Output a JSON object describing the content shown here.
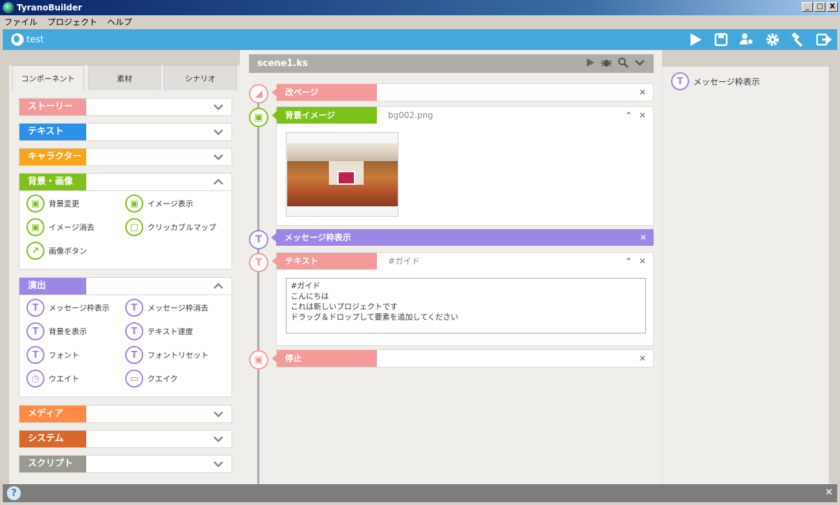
{
  "window": {
    "title": "TyranoBuilder",
    "minimize": "_",
    "maximize": "□",
    "close": "X"
  },
  "menu": [
    "ファイル",
    "プロジェクト",
    "ヘルプ"
  ],
  "toolbar": {
    "project": "test",
    "icons": [
      "play-icon",
      "save-icon",
      "users-icon",
      "settings-icon",
      "build-icon",
      "export-icon"
    ]
  },
  "tabs": [
    "コンポーネント",
    "素材",
    "シナリオ"
  ],
  "categories": {
    "story": "ストーリー",
    "text": "テキスト",
    "character": "キャラクター",
    "bg": "背景・画像",
    "effect": "演出",
    "media": "メディア",
    "system": "システム",
    "script": "スクリプト"
  },
  "bg_items": [
    "背景変更",
    "イメージ表示",
    "イメージ消去",
    "クリッカブルマップ",
    "画像ボタン"
  ],
  "effect_items": [
    "メッセージ枠表示",
    "メッセージ枠消去",
    "背景を表示",
    "テキスト速度",
    "フォント",
    "フォントリセット",
    "ウエイト",
    "クエイク"
  ],
  "scene": {
    "name": "scene1.ks"
  },
  "blocks": {
    "page": {
      "label": "改ページ"
    },
    "bg": {
      "label": "背景イメージ",
      "param": "bg002.png"
    },
    "msgwin": {
      "label": "メッセージ枠表示"
    },
    "text": {
      "label": "テキスト",
      "param": "#ガイド",
      "content": "#ガイド\nこんにちは\nこれは新しいプロジェクトです\nドラッグ＆ドロップして要素を追加してください"
    },
    "stop": {
      "label": "停止"
    }
  },
  "right": {
    "item": "メッセージ枠表示"
  },
  "status": {
    "help": "?",
    "close": "✕"
  },
  "colors": {
    "story": "#f39a9a",
    "text": "#2c8fe8",
    "character": "#f7a51c",
    "bg": "#7dc11b",
    "effect": "#9c86e6",
    "media": "#ff8a45",
    "system": "#d9682a",
    "script": "#9a9a90",
    "toolbar": "#45a8dd"
  }
}
